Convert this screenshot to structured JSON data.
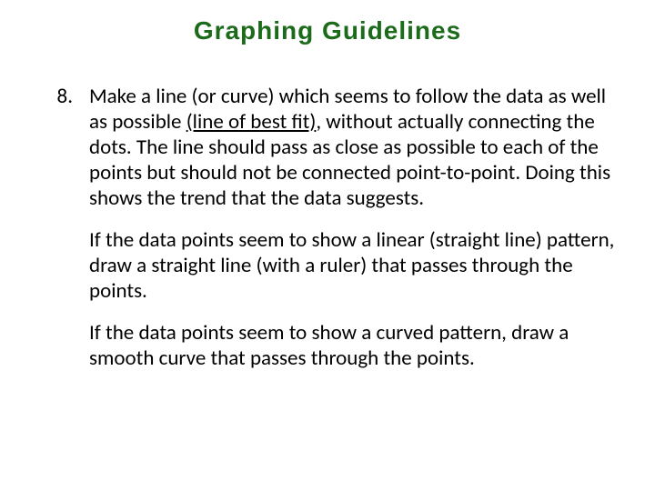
{
  "title": "Graphing Guidelines",
  "item": {
    "marker": "8.",
    "p1_a": "Make a line (or curve) which seems to follow the data as well as possible ",
    "p1_u": "(line of best fit)",
    "p1_b": ", without actually connecting the dots.  The line should pass as close as possible to each of the points but should not be connected point-to-point. Doing this shows the trend that the data suggests.",
    "p2": "If the data points seem to show a linear (straight line) pattern, draw a straight line (with a ruler) that passes through the points.",
    "p3": "If the data points seem to show a curved pattern, draw a smooth curve that passes through the points."
  }
}
